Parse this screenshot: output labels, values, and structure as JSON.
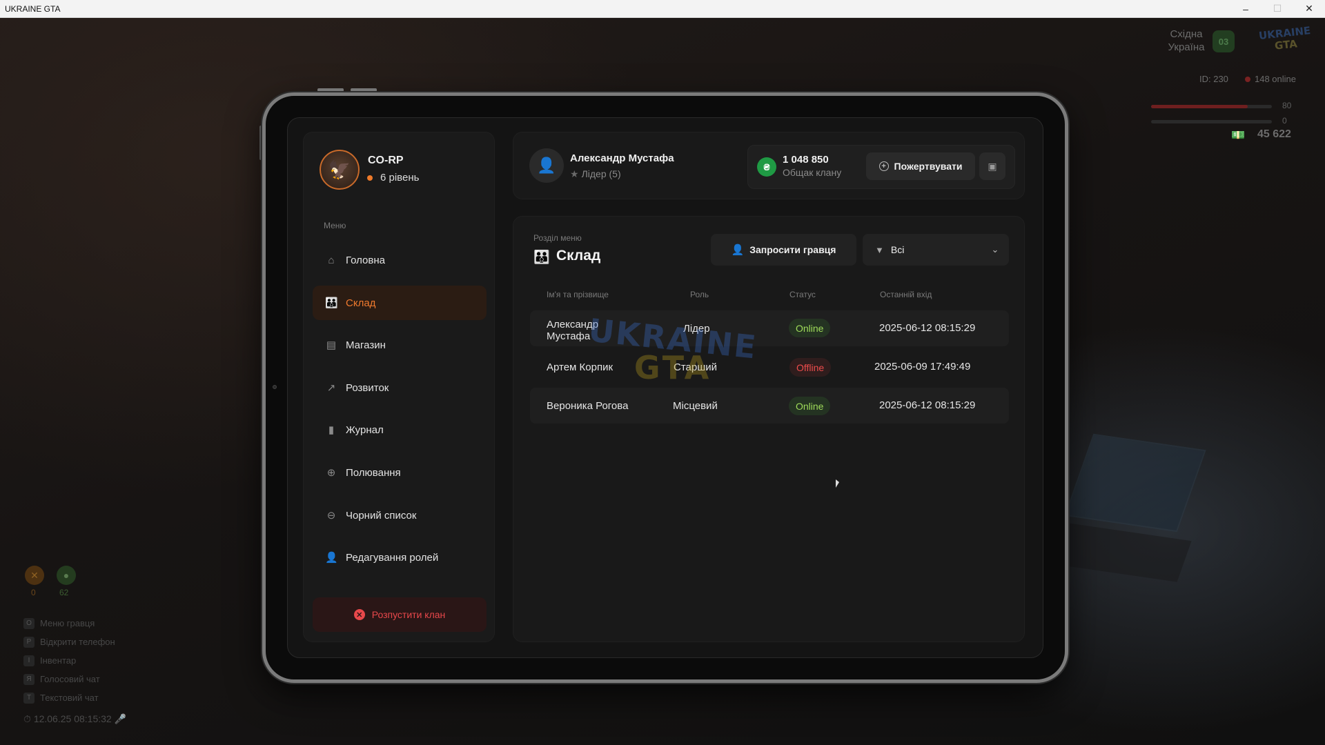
{
  "window": {
    "title": "UKRAINE GTA",
    "minimize": "–",
    "maximize": "☐",
    "close": "✕"
  },
  "hud": {
    "region_line1": "Східна",
    "region_line2": "Україна",
    "region_code": "03",
    "logo_line1": "UKRAINE",
    "logo_line2": "GTA",
    "player_id": "ID: 230",
    "online": "148 online",
    "health_value": "80",
    "armor_value": "0",
    "money": "45 622",
    "food_value": "0",
    "water_value": "62",
    "keys": [
      {
        "key": "O",
        "label": "Меню гравця"
      },
      {
        "key": "P",
        "label": "Відкрити телефон"
      },
      {
        "key": "I",
        "label": "Інвентар"
      },
      {
        "key": "Я",
        "label": "Голосовий чат"
      },
      {
        "key": "T",
        "label": "Текстовий чат"
      }
    ],
    "datetime": "12.06.25 08:15:32"
  },
  "clan": {
    "name": "CO-RP",
    "level": "6 рівень",
    "menu_label": "Меню",
    "menu": [
      {
        "label": "Головна",
        "icon": "home-icon",
        "glyph": "⌂"
      },
      {
        "label": "Склад",
        "icon": "members-icon",
        "glyph": "👪"
      },
      {
        "label": "Магазин",
        "icon": "shop-icon",
        "glyph": "▤"
      },
      {
        "label": "Розвиток",
        "icon": "chart-icon",
        "glyph": "↗"
      },
      {
        "label": "Журнал",
        "icon": "book-icon",
        "glyph": "▮"
      },
      {
        "label": "Полювання",
        "icon": "crosshair-icon",
        "glyph": "⊕"
      },
      {
        "label": "Чорний список",
        "icon": "blacklist-icon",
        "glyph": "⊖"
      },
      {
        "label": "Редагування ролей",
        "icon": "role-edit-icon",
        "glyph": "👤"
      }
    ],
    "active_menu": "Склад",
    "dissolve_label": "Розпустити клан"
  },
  "player": {
    "name": "Александр Мустафа",
    "role": "Лідер (5)"
  },
  "bank": {
    "amount": "1 048 850",
    "label": "Общак клану",
    "currency_symbol": "₴",
    "donate_label": "Пожертвувати"
  },
  "section": {
    "subtitle": "Розділ меню",
    "title": "Склад",
    "invite_label": "Запросити гравця",
    "filter_value": "Всі"
  },
  "table": {
    "headers": [
      "Ім'я та прізвище",
      "Роль",
      "Статус",
      "Останній вхід"
    ],
    "rows": [
      {
        "name_line1": "Александр",
        "name_line2": "Мустафа",
        "role": "Лідер",
        "status": "Online",
        "last_login": "2025-06-12 08:15:29"
      },
      {
        "name": "Артем Корпик",
        "role": "Старший",
        "status": "Offline",
        "last_login": "2025-06-09 17:49:49"
      },
      {
        "name": "Вероника Рогова",
        "role": "Місцевий",
        "status": "Online",
        "last_login": "2025-06-12 08:15:29"
      }
    ]
  },
  "watermark": {
    "line1": "UKRAINE",
    "line2": "GTA"
  },
  "colors": {
    "accent": "#f07a2e",
    "online": "#9fdc5a",
    "offline": "#ee4c4c",
    "danger": "#e8484b",
    "bank_green": "#1f9a44"
  }
}
